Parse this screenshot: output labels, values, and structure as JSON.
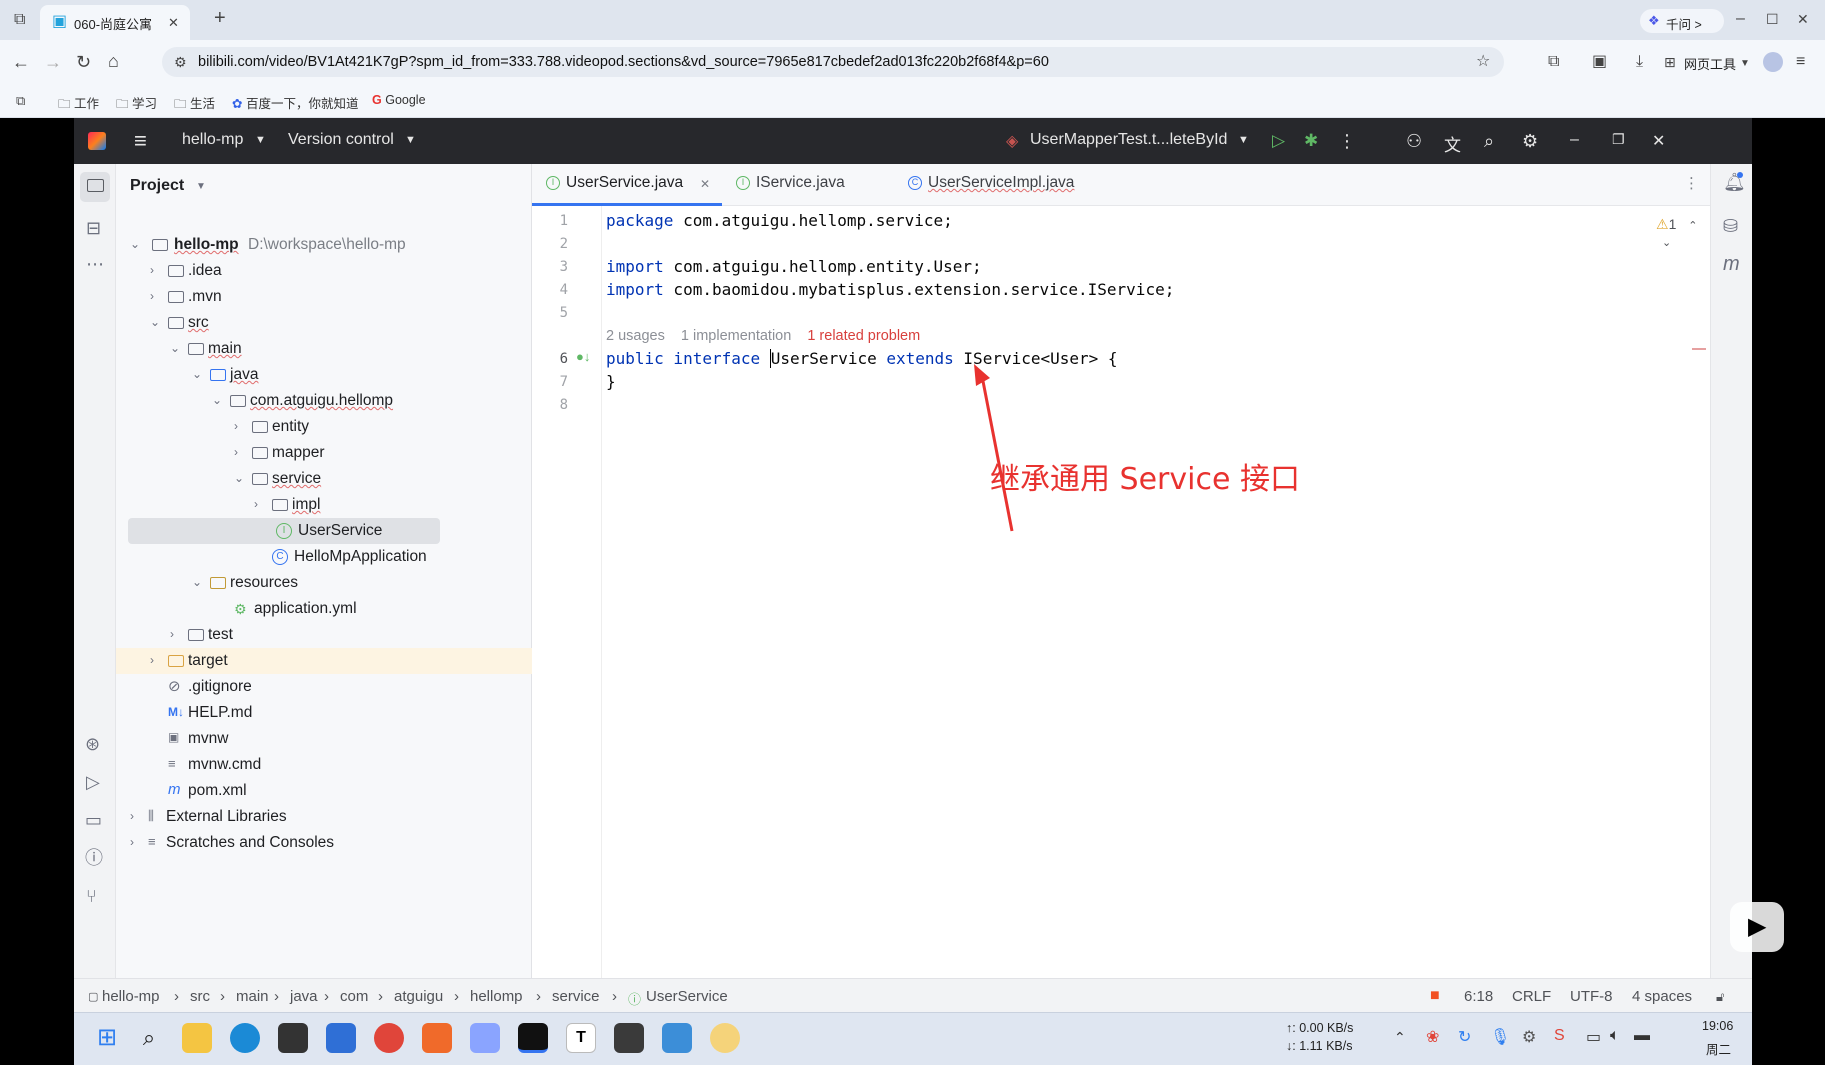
{
  "browser": {
    "tab_title": "060-尚庭公寓",
    "url": "bilibili.com/video/BV1At421K7gP?spm_id_from=333.788.videopod.sections&vd_source=7965e817cbedef2ad013fc220b2f68f4&p=60",
    "qianwen_label": "千问 >",
    "web_tools_label": "网页工具",
    "bookmarks": [
      "工作",
      "学习",
      "生活",
      "百度一下，你就知道",
      "Google"
    ]
  },
  "ide": {
    "project_name": "hello-mp",
    "version_control": "Version control",
    "run_config": "UserMapperTest.t...leteById",
    "project_panel_title": "Project",
    "tree": [
      {
        "label": "hello-mp",
        "extra": "D:\\workspace\\hello-mp"
      },
      {
        "label": ".idea"
      },
      {
        "label": ".mvn"
      },
      {
        "label": "src"
      },
      {
        "label": "main"
      },
      {
        "label": "java"
      },
      {
        "label": "com.atguigu.hellomp"
      },
      {
        "label": "entity"
      },
      {
        "label": "mapper"
      },
      {
        "label": "service"
      },
      {
        "label": "impl"
      },
      {
        "label": "UserService"
      },
      {
        "label": "HelloMpApplication"
      },
      {
        "label": "resources"
      },
      {
        "label": "application.yml"
      },
      {
        "label": "test"
      },
      {
        "label": "target"
      },
      {
        "label": ".gitignore"
      },
      {
        "label": "HELP.md"
      },
      {
        "label": "mvnw"
      },
      {
        "label": "mvnw.cmd"
      },
      {
        "label": "pom.xml"
      },
      {
        "label": "External Libraries"
      },
      {
        "label": "Scratches and Consoles"
      }
    ],
    "editor_tabs": [
      "UserService.java",
      "IService.java",
      "UserServiceImpl.java"
    ],
    "line_numbers": [
      "1",
      "2",
      "3",
      "4",
      "5",
      "6",
      "7",
      "8"
    ],
    "code": {
      "line1_kw": "package",
      "line1_rest": " com.atguigu.hellomp.service;",
      "line3_kw": "import",
      "line3_rest": " com.atguigu.hellomp.entity.User;",
      "line4_kw": "import",
      "line4_rest": " com.baomidou.mybatisplus.extension.service.IService;",
      "inlay_usages": "2 usages",
      "inlay_impl": "1 implementation",
      "inlay_problem": "1 related problem",
      "line6_kw1": "public interface ",
      "line6_name": "UserService ",
      "line6_kw2": "extends ",
      "line6_rest": "IService<User> {",
      "line7": "}"
    },
    "warning_count": "1",
    "annotation": "继承通用 Service 接口",
    "breadcrumb": [
      "hello-mp",
      "src",
      "main",
      "java",
      "com",
      "atguigu",
      "hellomp",
      "service",
      "UserService"
    ],
    "status": {
      "position": "6:18",
      "line_sep": "CRLF",
      "encoding": "UTF-8",
      "indent": "4 spaces"
    }
  },
  "taskbar": {
    "net_up": "↑: 0.00 KB/s",
    "net_down": "↓: 1.11 KB/s",
    "time": "19:06",
    "day": "周二"
  },
  "colors": {
    "accent_red": "#e8322f",
    "keyword": "#0033b3",
    "ide_titlebar": "#27282c"
  }
}
